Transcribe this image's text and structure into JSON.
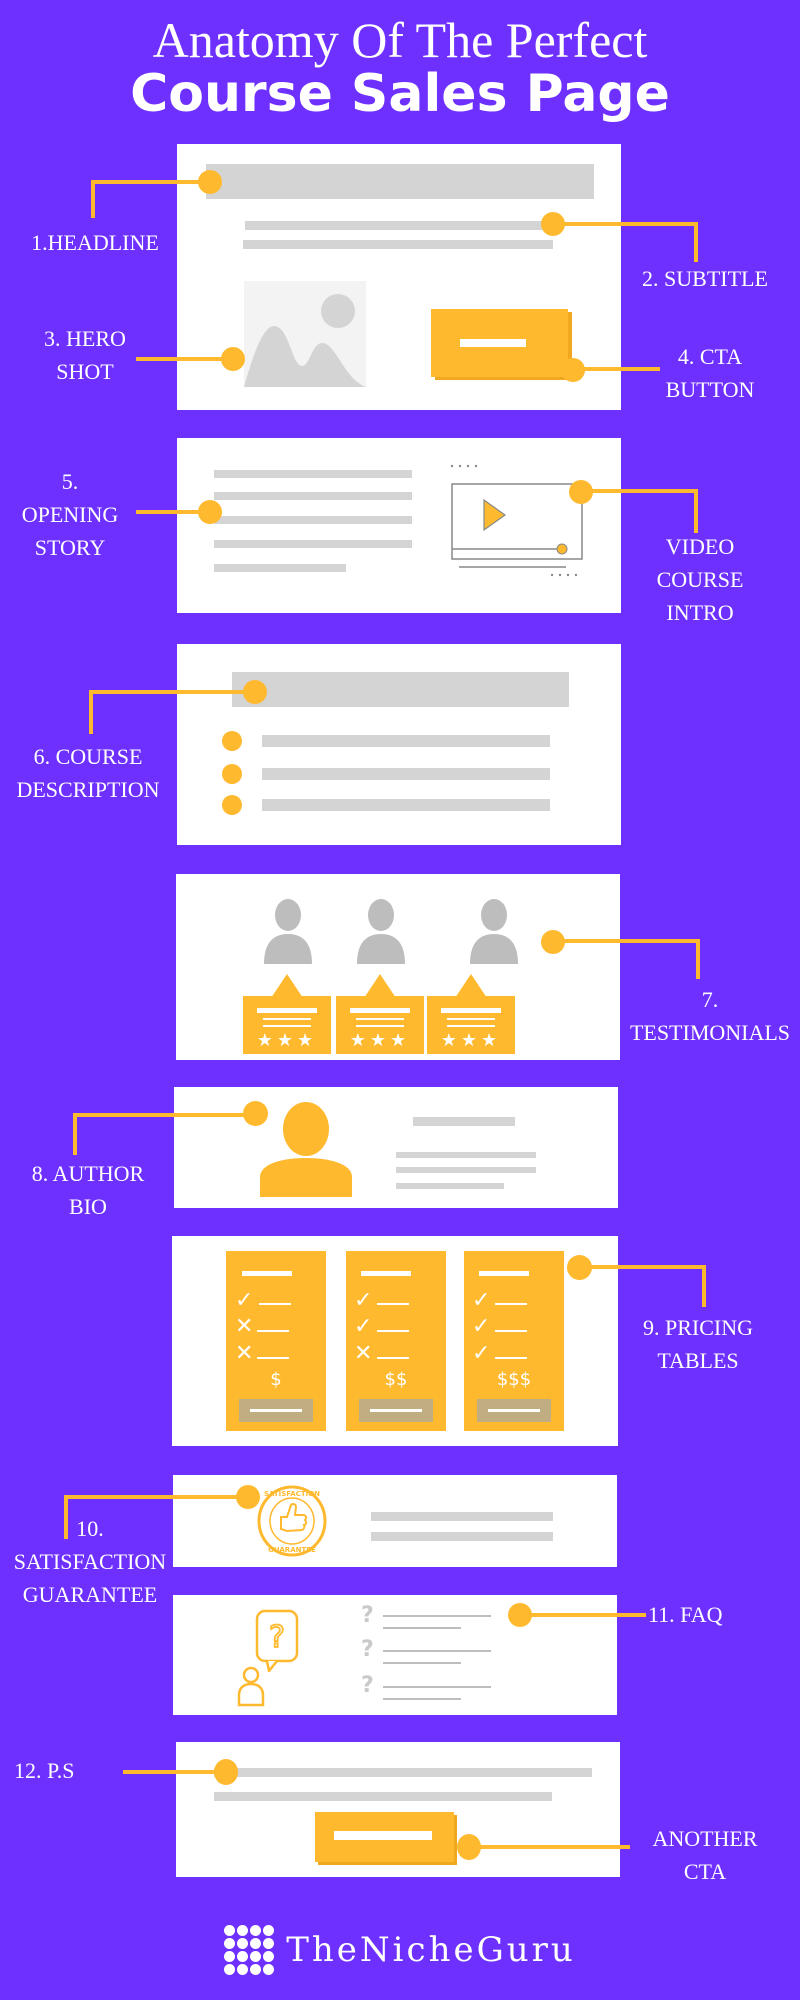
{
  "header": {
    "title_line1": "Anatomy Of The Perfect",
    "title_line2": "Course Sales Page"
  },
  "colors": {
    "background": "#6e30ff",
    "accent": "#ffb92e",
    "placeholder_gray": "#d4d4d4",
    "panel": "#ffffff"
  },
  "labels": {
    "headline": "1.HEADLINE",
    "subtitle": "2. SUBTITLE",
    "hero_shot": "3. HERO\nSHOT",
    "cta_button": "4. CTA\nBUTTON",
    "opening_story": "5.\nOPENING\nSTORY",
    "video_intro": "VIDEO\nCOURSE\nINTRO",
    "course_description": "6. COURSE\nDESCRIPTION",
    "testimonials": "7.\nTESTIMONIALS",
    "author_bio": "8. AUTHOR\nBIO",
    "pricing_tables": "9. PRICING\nTABLES",
    "satisfaction_guarantee": "10.\nSATISFACTION\nGUARANTEE",
    "faq": "11. FAQ",
    "ps": "12. P.S",
    "another_cta": "ANOTHER\nCTA"
  },
  "testimonials": {
    "stars": "★★★"
  },
  "pricing": {
    "tiers": [
      {
        "price": "$",
        "features": [
          "✓",
          "✕",
          "✕"
        ]
      },
      {
        "price": "$$",
        "features": [
          "✓",
          "✓",
          "✕"
        ]
      },
      {
        "price": "$$$",
        "features": [
          "✓",
          "✓",
          "✓"
        ]
      }
    ]
  },
  "guarantee_badge": {
    "top_text": "SATISFACTION",
    "bottom_text": "GUARANTEE"
  },
  "faq": {
    "question_mark": "?"
  },
  "footer": {
    "brand": "TheNicheGuru"
  }
}
